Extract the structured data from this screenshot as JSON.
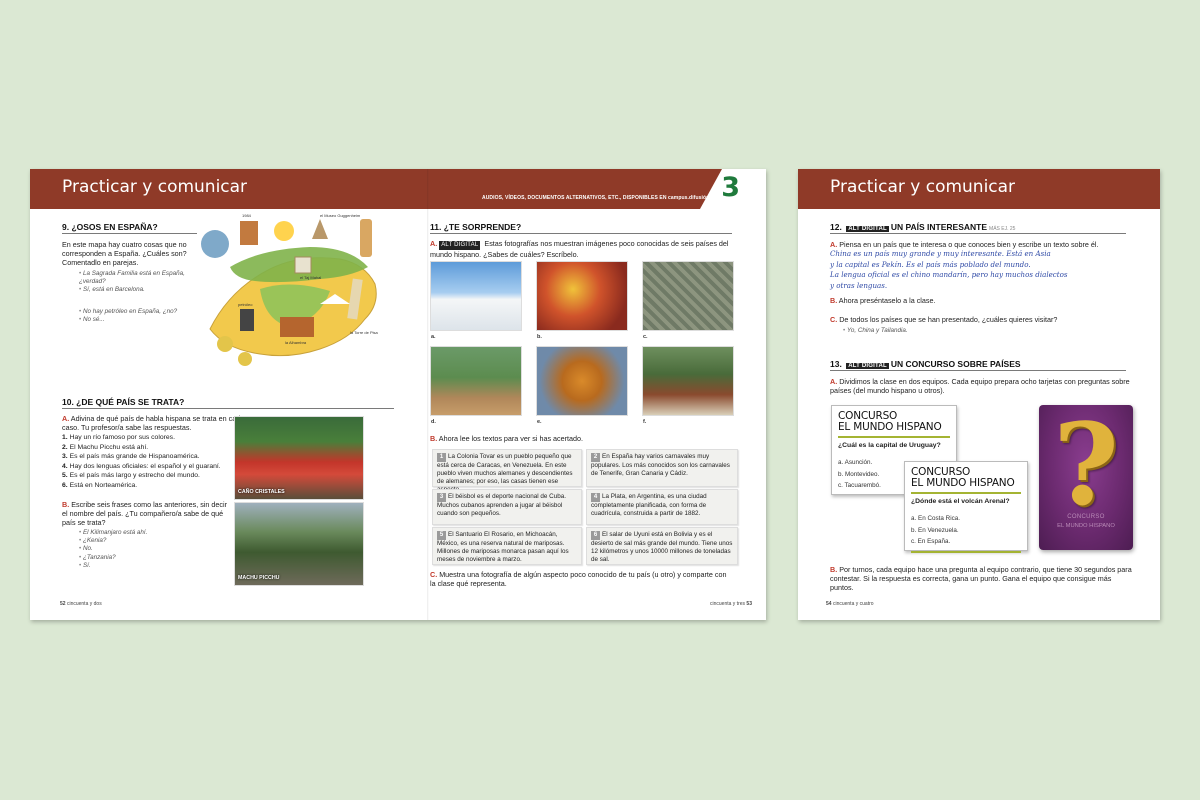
{
  "spread": {
    "header_title": "Practicar y comunicar",
    "header_note_prefix": "AUDIOS, VÍDEOS, DOCUMENTOS ALTERNATIVOS, ETC., DISPONIBLES EN",
    "header_note_link": "campus",
    "header_note_suffix": "difusión",
    "unit_number": "3",
    "s9": {
      "title": "9.  ¿OSOS EN ESPAÑA?",
      "intro": "En este mapa hay cuatro cosas que no corresponden a España. ¿Cuáles son? Comentadlo en parejas.",
      "examples_a": [
        "La Sagrada Familia está en España, ¿verdad?",
        "Sí, está en Barcelona."
      ],
      "examples_b": [
        "No hay petróleo en España, ¿no?",
        "No sé..."
      ],
      "map_labels": [
        "la Sagrada Familia",
        "pingüinos",
        "el Museo Guggenheim",
        "el Taj Mahal",
        "camellos",
        "petróleo",
        "la Alhambra",
        "la Torre de Pisa",
        "el templo de Debod",
        "molinos de viento",
        "la Giralda",
        "1984"
      ]
    },
    "s10": {
      "title": "10.  ¿DE QUÉ PAÍS SE TRATA?",
      "a_letter": "A.",
      "a_text": "Adivina de qué país de habla hispana se trata en cada caso. Tu profesor/a sabe las respuestas.",
      "items": [
        {
          "n": "1.",
          "t": "Hay un río famoso por sus colores."
        },
        {
          "n": "2.",
          "t": "El Machu Picchu está ahí."
        },
        {
          "n": "3.",
          "t": "Es el país más grande de Hispanoamérica."
        },
        {
          "n": "4.",
          "t": "Hay dos lenguas oficiales: el español y el guaraní."
        },
        {
          "n": "5.",
          "t": "Es el país más largo y estrecho del mundo."
        },
        {
          "n": "6.",
          "t": "Está en Norteamérica."
        }
      ],
      "b_letter": "B.",
      "b_text": "Escribe seis frases como las anteriores, sin decir el nombre del país. ¿Tu compañero/a sabe de qué país se trata?",
      "examples": [
        "El Kilimanjaro está ahí.",
        "¿Kenia?",
        "No.",
        "¿Tanzania?",
        "Sí."
      ],
      "photo1_caption": "CAÑO CRISTALES",
      "photo2_caption": "MACHU PICCHU"
    },
    "s11": {
      "title": "11.  ¿TE SORPRENDE?",
      "a_letter": "A.",
      "tag": "ALT DIGITAL",
      "a_text": "Estas fotografías nos muestran imágenes poco conocidas de seis países del mundo hispano. ¿Sabes de cuáles? Escríbelo.",
      "photo_letters": [
        "a.",
        "b.",
        "c.",
        "d.",
        "e.",
        "f."
      ],
      "b_letter": "B.",
      "b_text": "Ahora lee los textos para ver si has acertado.",
      "texts": [
        {
          "n": "1",
          "t": "La Colonia Tovar es un pueblo pequeño que está cerca de Caracas, en Venezuela. En este pueblo viven muchos alemanes y descendientes de alemanes; por eso, las casas tienen ese aspecto."
        },
        {
          "n": "2",
          "t": "En España hay varios carnavales muy populares. Los más conocidos son los carnavales de Tenerife, Gran Canaria y Cádiz."
        },
        {
          "n": "3",
          "t": "El béisbol es el deporte nacional de Cuba. Muchos cubanos aprenden a jugar al béisbol cuando son pequeños."
        },
        {
          "n": "4",
          "t": "La Plata, en Argentina, es una ciudad completamente planificada, con forma de cuadrícula, construida a partir de 1882."
        },
        {
          "n": "5",
          "t": "El Santuario El Rosario, en Michoacán, México, es una reserva natural de mariposas. Millones de mariposas monarca pasan aquí los meses de noviembre a marzo."
        },
        {
          "n": "6",
          "t": "El salar de Uyuni está en Bolivia y es el desierto de sal más grande del mundo. Tiene unos 12 kilómetros y unos 10000 millones de toneladas de sal."
        }
      ],
      "c_letter": "C.",
      "c_text": "Muestra una fotografía de algún aspecto poco conocido de tu país (u otro) y comparte con la clase qué representa."
    },
    "folio_left_num": "52",
    "folio_left_text": "cincuenta y dos",
    "folio_right_text": "cincuenta y tres",
    "folio_right_num": "53"
  },
  "single": {
    "header_title": "Practicar y comunicar",
    "s12": {
      "title_num": "12.",
      "tag": "ALT DIGITAL",
      "title": "UN PAÍS INTERESANTE",
      "ref": "MÁS EJ. 25",
      "a_letter": "A.",
      "a_text": "Piensa en un país que te interesa o que conoces bien y escribe un texto sobre él.",
      "handwriting": [
        "China es un país muy grande y muy interesante. Está en Asia",
        "y la capital es Pekín. Es el país más poblado del mundo.",
        "La lengua oficial es el chino mandarín, pero hay muchos dialectos",
        "y otras lenguas."
      ],
      "b_letter": "B.",
      "b_text": "Ahora preséntaselo a la clase.",
      "c_letter": "C.",
      "c_text": "De todos los países que se han presentado, ¿cuáles quieres visitar?",
      "example": "Yo, China y Tailandia."
    },
    "s13": {
      "title_num": "13.",
      "tag": "ALT DIGITAL",
      "title": "UN CONCURSO SOBRE PAÍSES",
      "a_letter": "A.",
      "a_text": "Dividimos la clase en dos equipos. Cada equipo prepara ocho tarjetas con preguntas sobre países (del mundo hispano u otros).",
      "card1": {
        "title1": "CONCURSO",
        "title2": "EL MUNDO HISPANO",
        "question": "¿Cuál es la capital de Uruguay?",
        "options": [
          "a. Asunción.",
          "b. Montevideo.",
          "c. Tacuarembó."
        ]
      },
      "card2": {
        "title1": "CONCURSO",
        "title2": "EL MUNDO HISPANO",
        "question": "¿Dónde está el volcán Arenal?",
        "options": [
          "a. En Costa Rica.",
          "b. En Venezuela.",
          "c. En España."
        ]
      },
      "poster_mark": "?",
      "poster_line1": "CONCURSO",
      "poster_line2": "EL MUNDO HISPANO",
      "b_letter": "B.",
      "b_text": "Por turnos, cada equipo hace una pregunta al equipo contrario, que tiene 30 segundos para contestar. Si la respuesta es correcta, gana un punto. Gana el equipo que consigue más puntos."
    },
    "folio_num": "54",
    "folio_text": "cincuenta y cuatro"
  },
  "colors": {
    "band": "#8f3a28",
    "unit": "#1f7a3c",
    "letter": "#c0392b",
    "handwriting": "#2f4aa6",
    "card_bar": "#a4b433",
    "poster": "#6b2a6f"
  }
}
